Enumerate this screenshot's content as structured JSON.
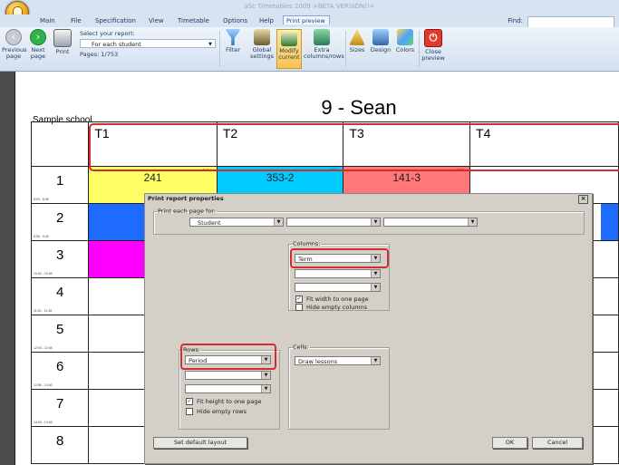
{
  "app": {
    "title": "aSc Timetables 2009  >BETA VERSION!!<"
  },
  "menu": {
    "tabs": [
      "Main",
      "File",
      "Specification",
      "View",
      "Timetable",
      "Options",
      "Help",
      "Print preview"
    ],
    "find_label": "Find:"
  },
  "ribbon": {
    "prev": "Previous page",
    "next": "Next page",
    "print": "Print",
    "select_report_label": "Select your report:",
    "report_value": "For each student",
    "pages": "Pages: 1/753",
    "filter": "Filter",
    "global": "Global settings",
    "modify": "Modify current",
    "extra": "Extra columns/rows",
    "sizes": "Sizes",
    "design": "Design",
    "colors": "Colors",
    "close": "Close preview"
  },
  "page": {
    "title": "9 - Sean",
    "school": "Sample school",
    "columns": [
      "T1",
      "T2",
      "T3",
      "T4"
    ],
    "rows": [
      {
        "n": "1",
        "t": "8:00 - 8:45"
      },
      {
        "n": "2",
        "t": "8:55 - 9:40"
      },
      {
        "n": "3",
        "t": "10:00 - 10:45"
      },
      {
        "n": "4",
        "t": "11:00 - 11:45"
      },
      {
        "n": "5",
        "t": "12:00 - 12:45"
      },
      {
        "n": "6",
        "t": "12:55 - 13:40"
      },
      {
        "n": "7",
        "t": "14:00 - 14:45"
      },
      {
        "n": "8",
        "t": ""
      }
    ],
    "row1_cells": [
      "241",
      "353-2",
      "141-3"
    ],
    "small_tag": "Senior",
    "small_room": "60"
  },
  "dialog": {
    "title": "Print report properties",
    "close": "×",
    "print_each_label": "Print each page for:",
    "print_each_value": "Student",
    "columns_label": "Columns:",
    "columns_value": "Term",
    "fit_width": "Fit width to one page",
    "hide_empty_cols": "Hide empty columns",
    "rows_label": "Rows:",
    "rows_value": "Period",
    "fit_height": "Fit height to one page",
    "hide_empty_rows": "Hide empty rows",
    "cells_label": "Cells:",
    "cells_value": "Draw lessons",
    "default_layout": "Set default layout",
    "ok": "OK",
    "cancel": "Cancel"
  },
  "colors": {
    "yellow": "#ffff66",
    "cyan": "#00ccff",
    "salmon": "#ff7777",
    "blue": "#1e6cff",
    "magenta": "#ff00ff",
    "accent_red": "#d32c2c"
  }
}
